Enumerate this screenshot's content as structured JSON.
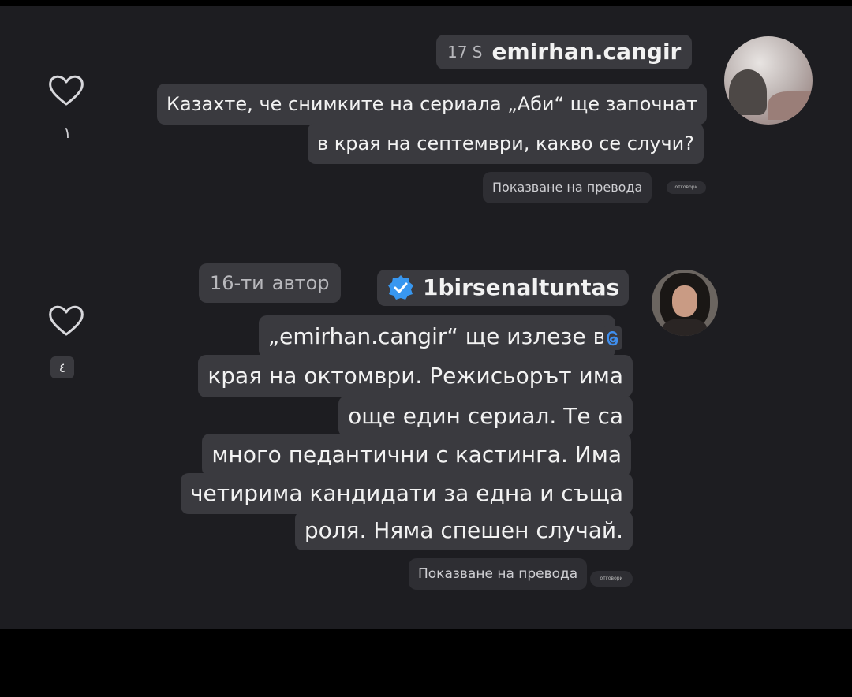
{
  "comments": [
    {
      "time": "17 S",
      "username": "emirhan.cangir",
      "lines": [
        "Казахте, че снимките на сериала „Аби“ ще започнат",
        "в края на септември, какво се случи?"
      ],
      "show_translation": "Показване на превода",
      "reply_label": "отговори",
      "like_count": "١",
      "like_icon": "heart-outline-icon"
    },
    {
      "time": "16-ти",
      "author_label": "автор",
      "username": "1birsenaltuntas",
      "verified_icon": "verified-badge-icon",
      "lines": [
        "„emirhan.cangir“ ще излезе в",
        "края на октомври. Режисьорът има",
        "още един сериал. Те са",
        "много педантични с кастинга. Има",
        "четирима кандидати за една и съща",
        "роля. Няма спешен случай."
      ],
      "threads_icon": "threads-logo-icon",
      "show_translation": "Показване на превода",
      "reply_label": "отговори",
      "like_count": "٤",
      "like_icon": "heart-outline-icon"
    }
  ],
  "colors": {
    "background": "#1d1d21",
    "bubble": "#3a3a3f",
    "verified": "#3897f0"
  }
}
